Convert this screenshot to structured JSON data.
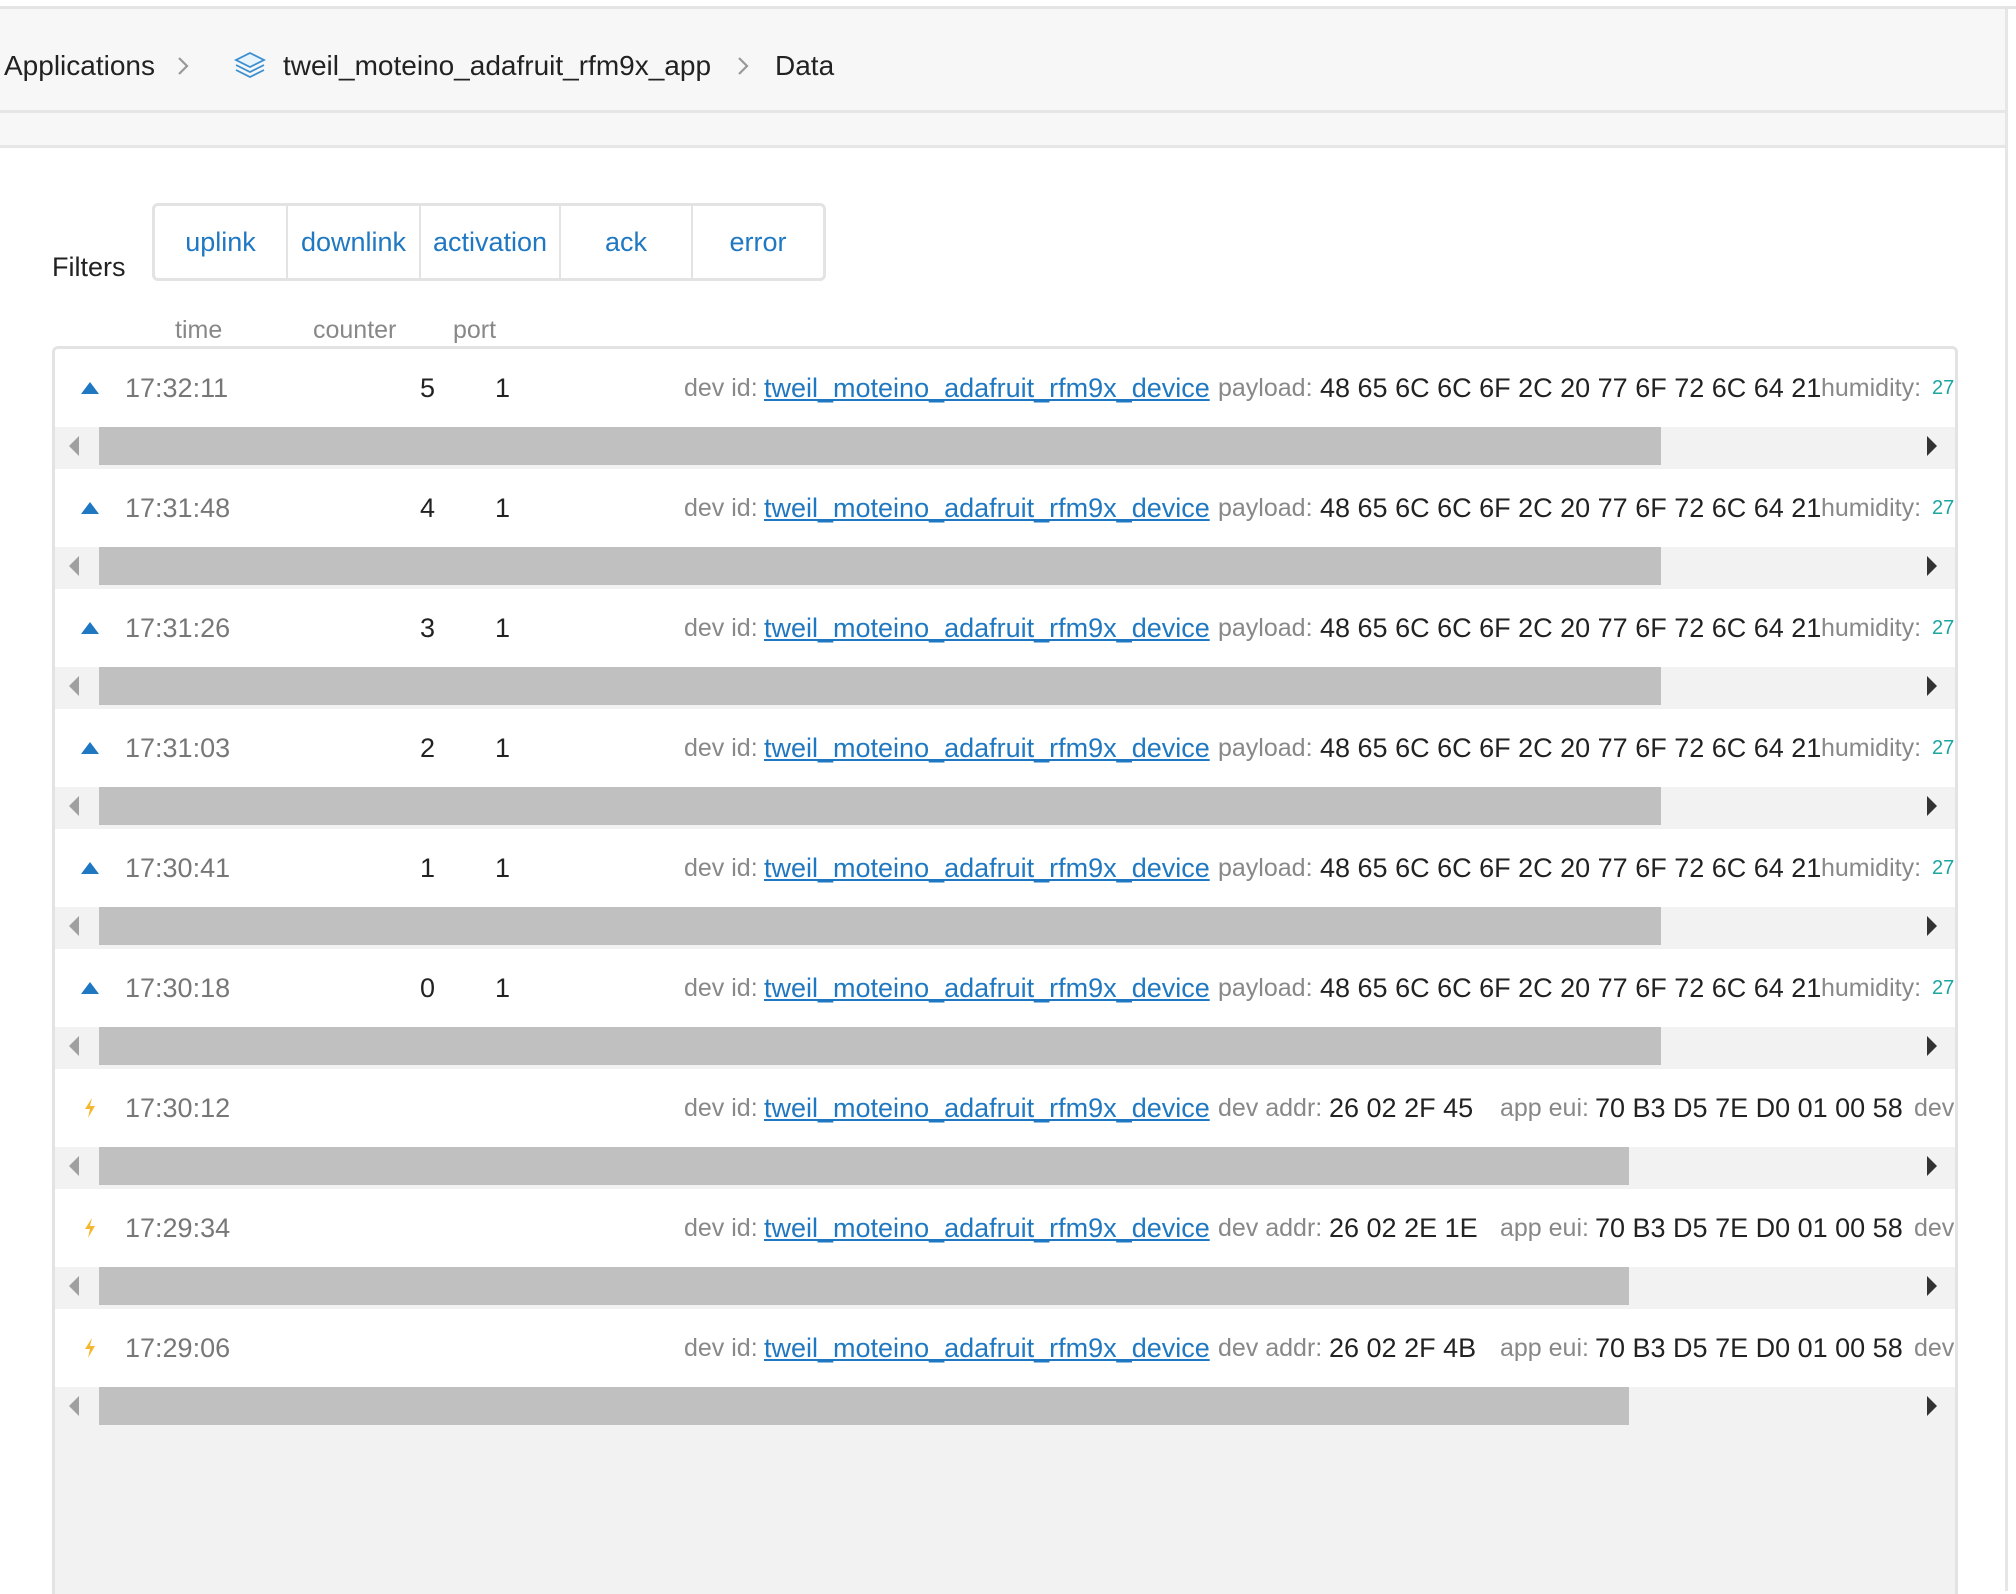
{
  "breadcrumb": {
    "root": "Applications",
    "app": "tweil_moteino_adafruit_rfm9x_app",
    "current": "Data"
  },
  "filters": {
    "label": "Filters",
    "buttons": [
      "uplink",
      "downlink",
      "activation",
      "ack",
      "error"
    ]
  },
  "columns": {
    "time": "time",
    "counter": "counter",
    "port": "port"
  },
  "labels": {
    "dev_id": "dev id:",
    "payload": "payload:",
    "humidity": "humidity:",
    "dev_addr": "dev addr:",
    "app_eui": "app eui:",
    "dev_more": "dev"
  },
  "uplinks": [
    {
      "time": "17:32:11",
      "counter": "5",
      "port": "1",
      "dev_id": "tweil_moteino_adafruit_rfm9x_device",
      "payload": "48 65 6C 6C 6F 2C 20 77 6F 72 6C 64 21",
      "humidity": "27"
    },
    {
      "time": "17:31:48",
      "counter": "4",
      "port": "1",
      "dev_id": "tweil_moteino_adafruit_rfm9x_device",
      "payload": "48 65 6C 6C 6F 2C 20 77 6F 72 6C 64 21",
      "humidity": "27"
    },
    {
      "time": "17:31:26",
      "counter": "3",
      "port": "1",
      "dev_id": "tweil_moteino_adafruit_rfm9x_device",
      "payload": "48 65 6C 6C 6F 2C 20 77 6F 72 6C 64 21",
      "humidity": "27"
    },
    {
      "time": "17:31:03",
      "counter": "2",
      "port": "1",
      "dev_id": "tweil_moteino_adafruit_rfm9x_device",
      "payload": "48 65 6C 6C 6F 2C 20 77 6F 72 6C 64 21",
      "humidity": "27"
    },
    {
      "time": "17:30:41",
      "counter": "1",
      "port": "1",
      "dev_id": "tweil_moteino_adafruit_rfm9x_device",
      "payload": "48 65 6C 6C 6F 2C 20 77 6F 72 6C 64 21",
      "humidity": "27"
    },
    {
      "time": "17:30:18",
      "counter": "0",
      "port": "1",
      "dev_id": "tweil_moteino_adafruit_rfm9x_device",
      "payload": "48 65 6C 6C 6F 2C 20 77 6F 72 6C 64 21",
      "humidity": "27"
    }
  ],
  "activations": [
    {
      "time": "17:30:12",
      "dev_id": "tweil_moteino_adafruit_rfm9x_device",
      "dev_addr": "26 02 2F 45",
      "app_eui": "70 B3 D5 7E D0 01 00 58"
    },
    {
      "time": "17:29:34",
      "dev_id": "tweil_moteino_adafruit_rfm9x_device",
      "dev_addr": "26 02 2E 1E",
      "app_eui": "70 B3 D5 7E D0 01 00 58"
    },
    {
      "time": "17:29:06",
      "dev_id": "tweil_moteino_adafruit_rfm9x_device",
      "dev_addr": "26 02 2F 4B",
      "app_eui": "70 B3 D5 7E D0 01 00 58"
    }
  ],
  "colors": {
    "link": "#1f78c1",
    "uplink_icon": "#1f78c1",
    "activation_icon": "#f5b630",
    "humidity_value": "#1aa5a0"
  },
  "icons": {
    "app": "layers-stack-icon",
    "separator": "chevron-right-icon",
    "uplink": "triangle-up-icon",
    "activation": "lightning-bolt-icon"
  }
}
